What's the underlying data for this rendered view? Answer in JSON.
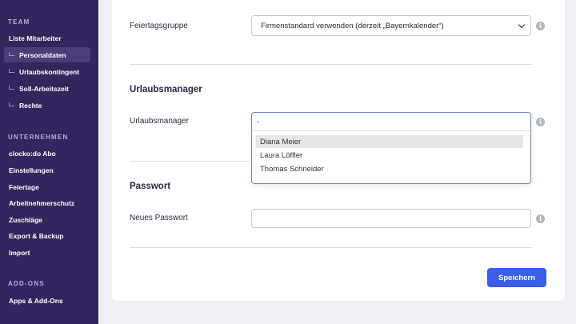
{
  "sidebar": {
    "sections": [
      {
        "title": "TEAM"
      },
      {
        "title": "UNTERNEHMEN"
      },
      {
        "title": "ADD-ONS"
      }
    ],
    "team_items": [
      {
        "label": "Liste Mitarbeiter"
      },
      {
        "label": "Personaldaten"
      },
      {
        "label": "Urlaubskontingent"
      },
      {
        "label": "Soll-Arbeitszeit"
      },
      {
        "label": "Rechte"
      }
    ],
    "company_items": [
      {
        "label": "clocko:do Abo"
      },
      {
        "label": "Einstellungen"
      },
      {
        "label": "Feiertage"
      },
      {
        "label": "Arbeitnehmerschutz"
      },
      {
        "label": "Zuschläge"
      },
      {
        "label": "Export & Backup"
      },
      {
        "label": "Import"
      }
    ],
    "addon_items": [
      {
        "label": "Apps & Add-Ons"
      }
    ]
  },
  "form": {
    "holiday_group_label": "Feiertagsgruppe",
    "holiday_group_value": "Firmenstandard verwenden (derzeit „Bayernkalender“)",
    "vacation_section_title": "Urlaubsmanager",
    "vacation_manager_label": "Urlaubsmanager",
    "vacation_manager_input": "-",
    "vacation_manager_options": [
      {
        "label": "Diana Meier"
      },
      {
        "label": "Laura Löffler"
      },
      {
        "label": "Thomas Schneider"
      }
    ],
    "password_section_title": "Passwort",
    "new_password_label": "Neues Passwort",
    "new_password_value": "",
    "save_label": "Speichern"
  },
  "icons": {
    "info": "info-icon",
    "chevron": "chevron-down-icon",
    "submenu": "submenu-indent-icon"
  },
  "colors": {
    "sidebar_bg": "#33255e",
    "accent": "#3b5fe6"
  }
}
